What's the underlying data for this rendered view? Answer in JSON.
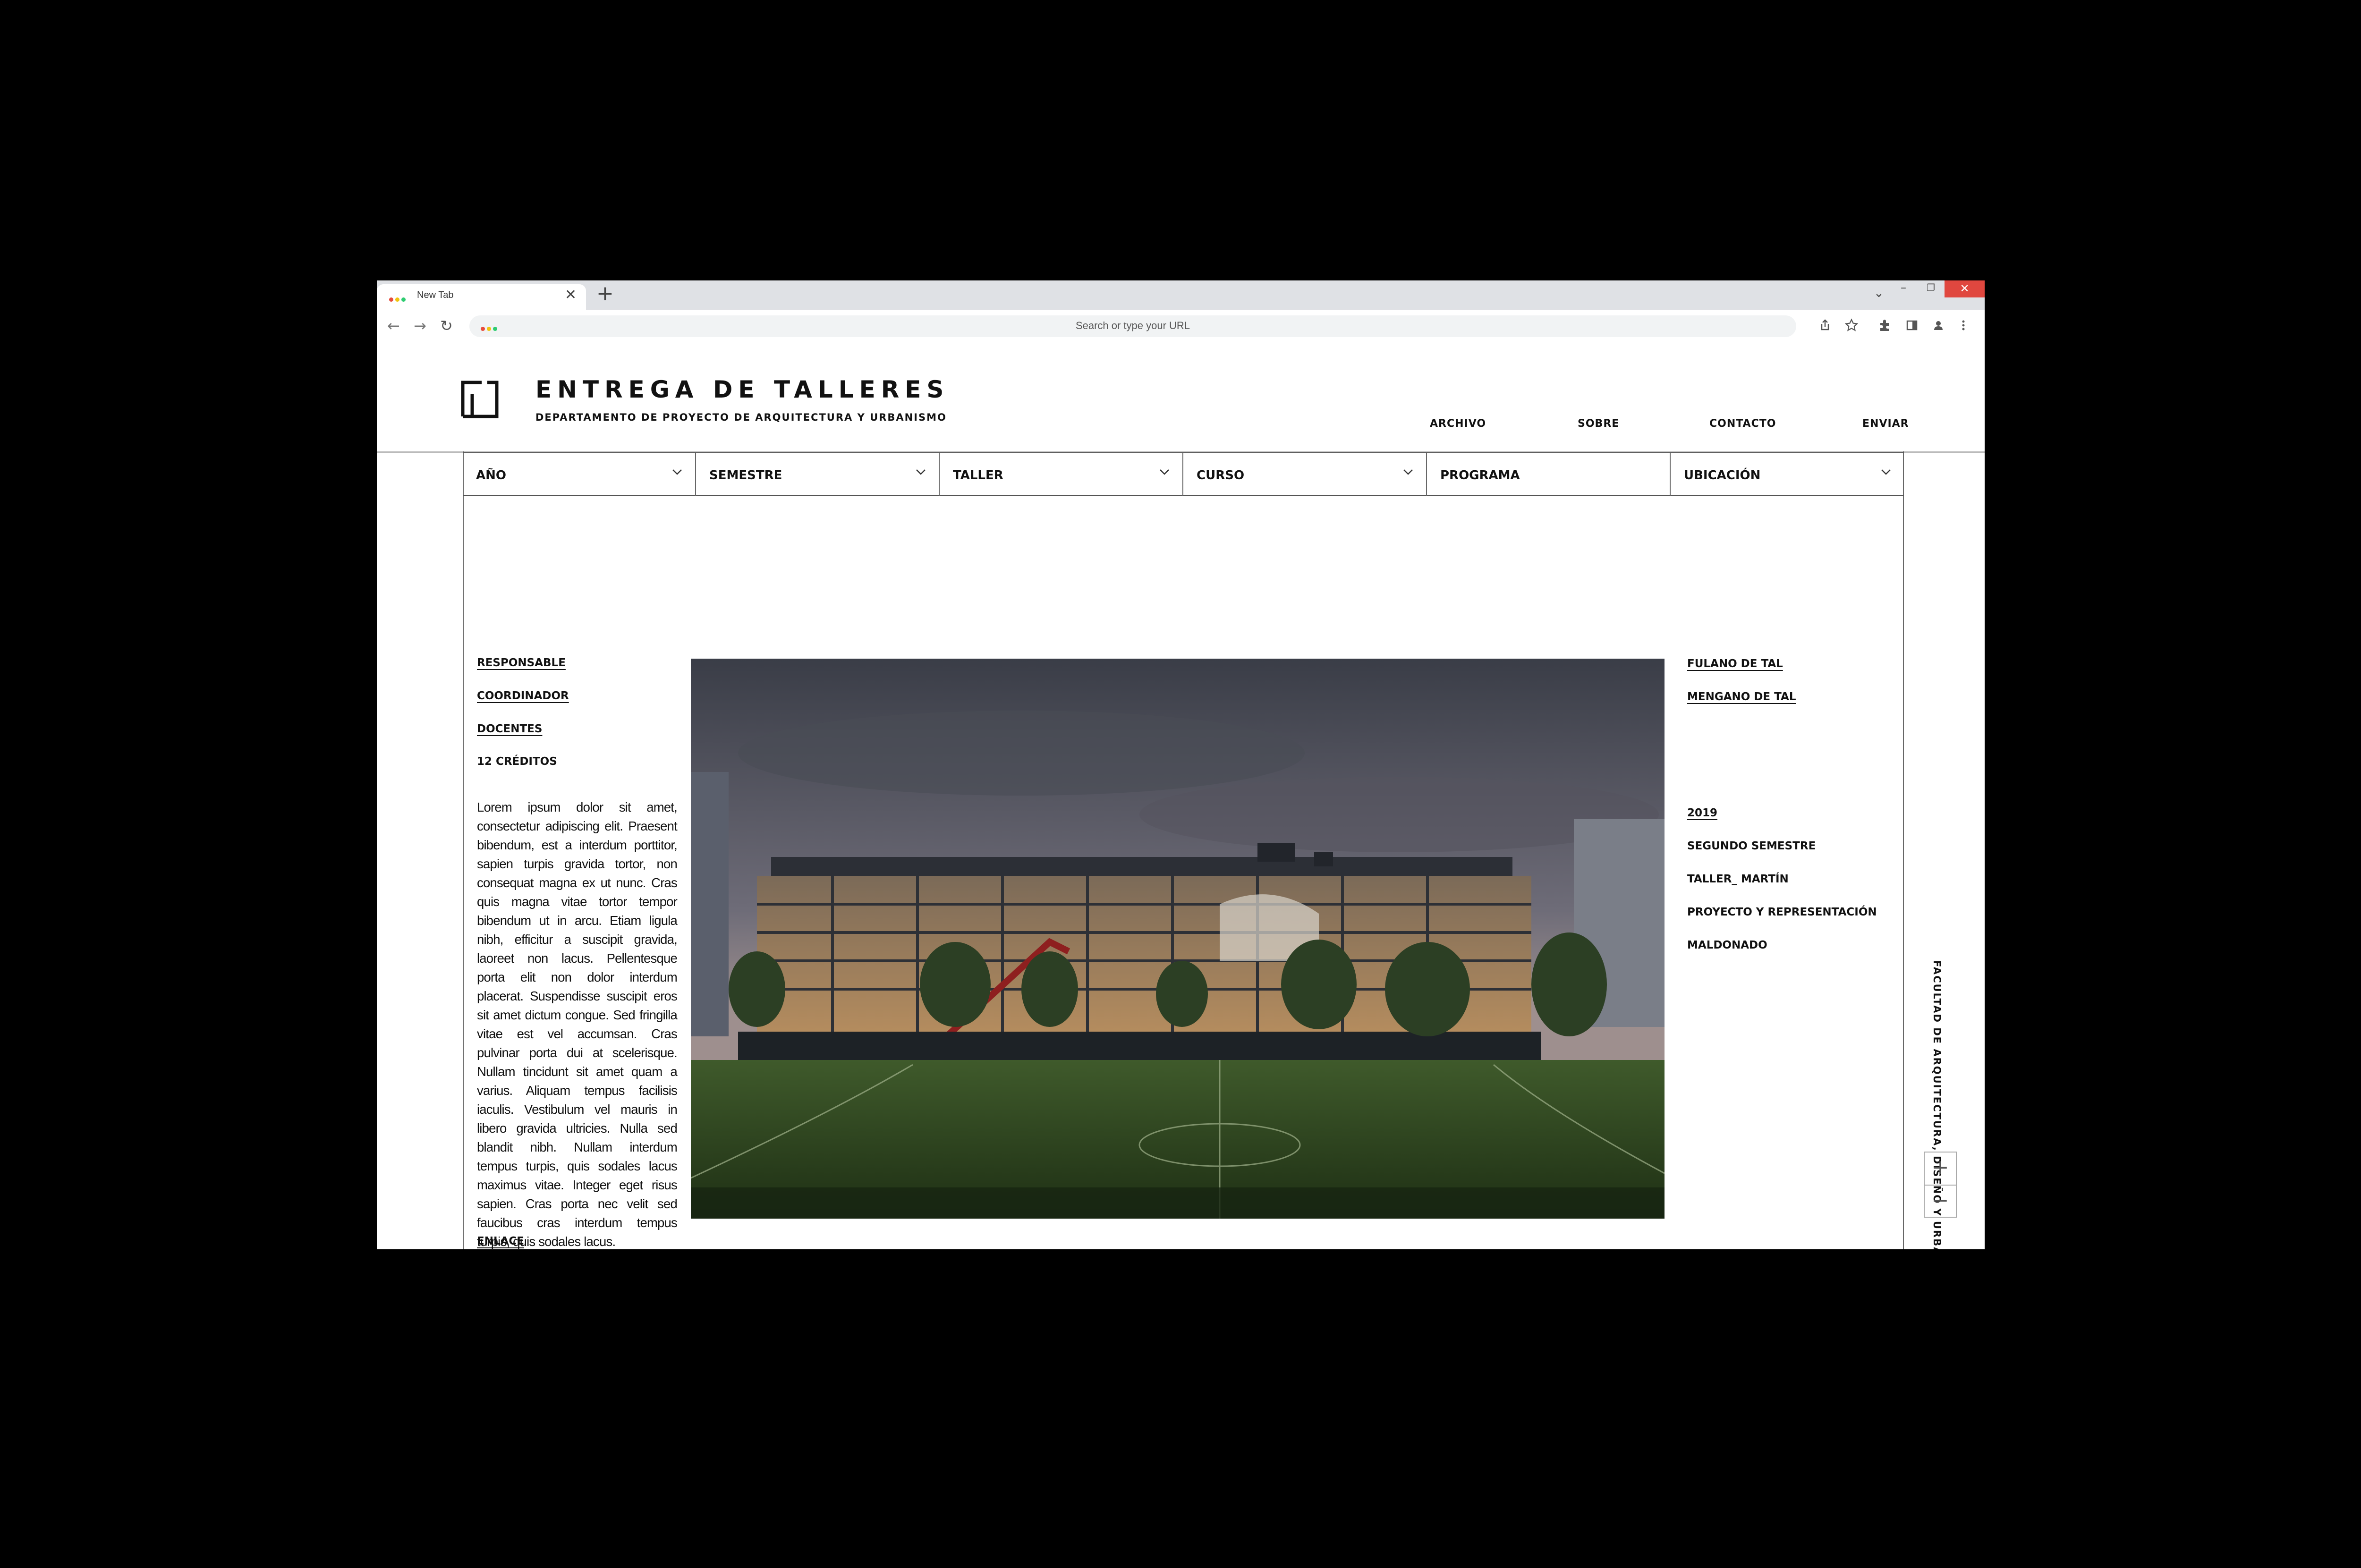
{
  "browser": {
    "tab_title": "New Tab",
    "tab_close": "✕",
    "new_tab": "+",
    "tabs_menu": "⌄",
    "minimize": "–",
    "restore": "❐",
    "close": "✕",
    "back": "←",
    "forward": "→",
    "reload": "↻",
    "address_placeholder": "Search or type your URL",
    "dot_colors": [
      "#e74c3c",
      "#f1c40f",
      "#2ecc71"
    ],
    "toolbar_icons": [
      "share-icon",
      "star-icon",
      "extensions-icon",
      "sidebar-icon",
      "profile-icon",
      "menu-icon"
    ]
  },
  "site": {
    "title": "ENTREGA DE TALLERES",
    "subtitle": "DEPARTAMENTO DE PROYECTO DE ARQUITECTURA Y URBANISMO"
  },
  "nav": [
    "ARCHIVO",
    "SOBRE",
    "CONTACTO",
    "ENVIAR"
  ],
  "filters": [
    "AÑO",
    "SEMESTRE",
    "TALLER",
    "CURSO",
    "PROGRAMA",
    "UBICACIÓN"
  ],
  "left_meta": [
    "RESPONSABLE",
    "COORDINADOR",
    "DOCENTES",
    "12 CRÉDITOS"
  ],
  "description": "Lorem ipsum dolor sit amet, consectetur adipiscing elit. Praesent bibendum, est a interdum porttitor, sapien turpis gravida tortor, non consequat magna ex ut nunc. Cras quis magna vitae tortor tempor bibendum ut in arcu. Etiam ligula nibh, efficitur a suscipit gravida, laoreet non lacus. Pellentesque porta elit non dolor interdum placerat. Suspendisse suscipit eros sit amet dictum congue. Sed fringilla vitae est vel accumsan. Cras pulvinar porta dui at scelerisque. Nullam tincidunt sit amet quam a varius. Aliquam tempus facilisis iaculis. Vestibulum vel mauris in libero gravida ultricies. Nulla sed blandit nibh. Nullam interdum tempus turpis, quis sodales lacus maximus vitae. Integer eget risus sapien. Cras porta nec velit sed faucibus cras interdum tempus turpis, quis sodales lacus.",
  "link_label": "ENLACE",
  "right_people": [
    "FULANO DE TAL",
    "MENGANO DE TAL"
  ],
  "right_details": [
    "2019",
    "SEGUNDO SEMESTRE",
    "TALLER_ MARTÍN",
    "PROYECTO Y REPRESENTACIÓN",
    "MALDONADO"
  ],
  "side_vertical": "FACULTAD DE ARQUITECTURA, DISEÑO Y URBANISMO_UDELAR",
  "zoom": {
    "in": "+",
    "out": "−"
  }
}
